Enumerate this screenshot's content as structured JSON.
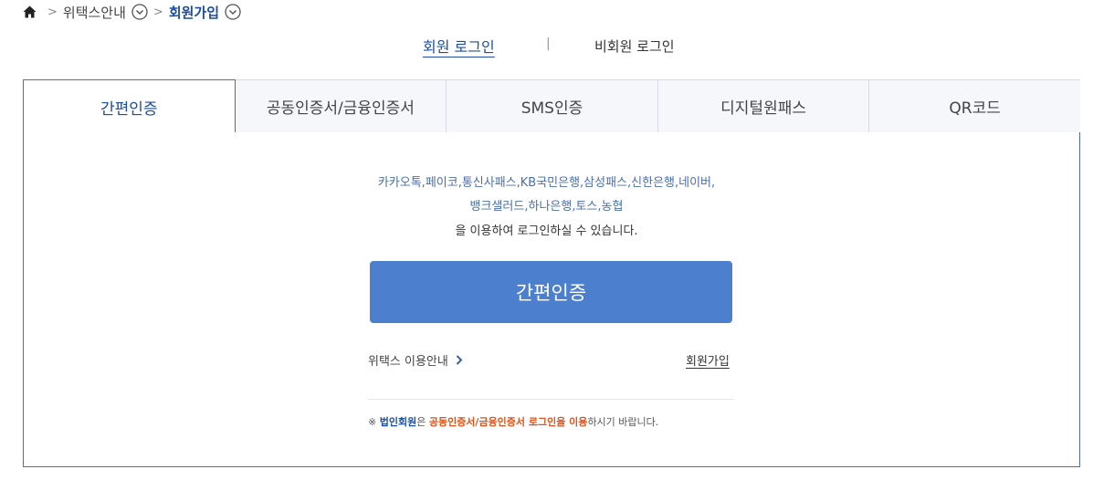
{
  "breadcrumb": {
    "home_icon": "home-icon",
    "items": [
      "위택스안내",
      "회원가입"
    ]
  },
  "login_switch": {
    "member_login": "회원 로그인",
    "divider": "|",
    "guest_login": "비회원 로그인"
  },
  "tabs": [
    "간편인증",
    "공동인증서/금융인증서",
    "SMS인증",
    "디지털원패스",
    "QR코드"
  ],
  "active_tab": 0,
  "panel": {
    "desc_line1": "카카오톡,페이코,통신사패스,KB국민은행,삼성패스,신한은행,네이버,",
    "desc_line2": "뱅크샐러드,하나은행,토스,농협",
    "desc_line3": "을 이용하여 로그인하실 수 있습니다.",
    "button_label": "간편인증",
    "guide_link": "위택스 이용안내",
    "signup_link": "회원가입",
    "notice": {
      "prefix": "※ ",
      "strong1": "법인회원",
      "text1": "은 ",
      "orange": "공동인증서/금융인증서 로그인을 이용",
      "text2": "하시기 바랍니다."
    }
  },
  "colors": {
    "primary": "#1e4ea1",
    "button": "#4c7fce",
    "accent_orange": "#d9541e"
  }
}
